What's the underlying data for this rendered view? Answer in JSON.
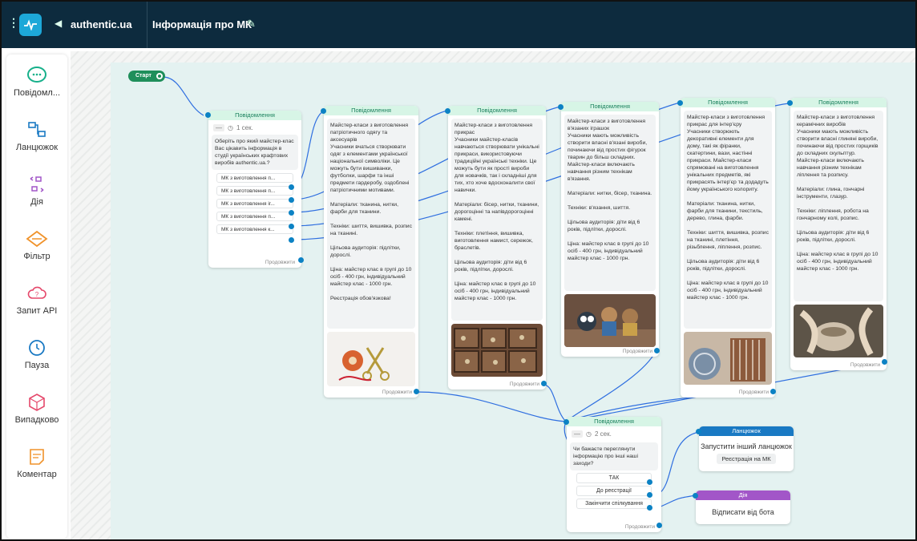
{
  "header": {
    "site": "authentic.ua",
    "title": "Інформація про МК"
  },
  "sidebar": {
    "items": [
      {
        "label": "Повідомл...",
        "icon": "message-bubble-icon"
      },
      {
        "label": "Ланцюжок",
        "icon": "chain-icon"
      },
      {
        "label": "Дія",
        "icon": "action-icon"
      },
      {
        "label": "Фільтр",
        "icon": "filter-icon"
      },
      {
        "label": "Запит API",
        "icon": "api-cloud-icon"
      },
      {
        "label": "Пауза",
        "icon": "clock-icon"
      },
      {
        "label": "Випадково",
        "icon": "dice-icon"
      },
      {
        "label": "Коментар",
        "icon": "note-icon"
      }
    ]
  },
  "colors": {
    "accent": "#1da8d8",
    "header": "#0d2b3e",
    "green": "#1f8f5b",
    "chain": "#1979c3",
    "action": "#a256c8"
  },
  "flow": {
    "start": "Старт",
    "message_header": "Повідомлення",
    "continue": "Продовжити",
    "node1": {
      "delay": "1 сек.",
      "text": "Оберіть про який майстер-клас Вас цікавить інформація в студії українських крафтових виробів authentic.ua.?",
      "options": [
        "МК з виготовлення п...",
        "МК з виготовлення п...",
        "МК з виготовлення іг...",
        "МК з виготовлення п...",
        "МК з виготовлення к..."
      ]
    },
    "node2": {
      "text": "Майстер-класи з виготовлення патріотичного одягу та аксесуарів\nУчасники вчаться створювати одяг з елементами української національної символіки. Це можуть бути вишиванки, футболки, шарфи та інші предмети гардеробу, оздоблені патріотичними мотивами.\n\nМатеріали: тканина, нитки, фарби для тканини.\n\nТехніки: шиття, вишивка, розпис на тканині.\n\nЦільова аудиторія: підлітки, дорослі.\n\nЦіна: майстер клас в групі до 10 осіб - 400 грн, індивідуальний майстер клас - 1000 грн.\n\nРеєстрація обов'язкова!"
    },
    "node3": {
      "text": "Майстер-класи з виготовлення прикрас\nУчасники майстер-класів навчаються створювати унікальні прикраси, використовуючи традиційні українські техніки. Це можуть бути як прості вироби для новачків, так і складніші для тих, хто хоче вдосконалити свої навички.\n\nМатеріали: бісер, нитки, тканини, дорогоцінні та напівдорогоцінні камені.\n\nТехніки: плетіння, вишивка, виготовлення намист, сережок, браслетів.\n\nЦільова аудиторія: діти від 6 років, підлітки, дорослі.\n\nЦіна: майстер клас в групі до 10 осіб - 400 грн, індивідуальний майстер клас - 1000 грн."
    },
    "node4": {
      "text": "Майстер-класи з виготовлення в'язаних іграшок\nУчасники мають можливість створити власні в'язані вироби, починаючи від простих фігурок тварин до більш складних. Майстер-класи включають навчання різним технікам в'язання.\n\nМатеріали: нитки, бісер, тканина.\n\nТехніки: в'язання, шиття.\n\nЦільова аудиторія: діти від 6 років, підлітки, дорослі.\n\nЦіна: майстер клас в групі до 10 осіб - 400 грн, індивідуальний майстер клас - 1000 грн."
    },
    "node5": {
      "text": "Майстер-класи з виготовлення прикрас для інтер'єру\nУчасники створюють декоративні елементи для дому, такі як фіранки, скатертини, вази, настінні прикраси. Майстер-класи спрямовані на виготовлення унікальних предметів, які прикрасять інтер'єр та додадуть йому українського колориту.\n\nМатеріали: тканина, нитки, фарби для тканини, текстиль, дерево, глина, фарби.\n\nТехніки: шиття, вишивка, розпис на тканині, плетіння, різьблення, ліплення, розпис.\n\nЦільова аудиторія: діти від 6 років, підлітки, дорослі.\n\nЦіна: майстер клас в групі до 10 осіб - 400 грн, індивідуальний майстер клас - 1000 грн."
    },
    "node6": {
      "text": "Майстер-класи з виготовлення керамічних виробів\nУчасники мають можливість створити власні глиняні вироби, починаючи від простих горщиків до складних скульптур. Майстер-класи включають навчання різним технікам ліплення та розпису.\n\nМатеріали: глина, гончарні інструменти, глазур.\n\nТехніки: ліплення, робота на гончарному колі, розпис.\n\nЦільова аудиторія: діти від 6 років, підлітки, дорослі.\n\nЦіна: майстер клас в групі до 10 осіб - 400 грн, індивідуальний майстер клас - 1000 грн."
    },
    "node7": {
      "delay": "2 сек.",
      "text": "Чи бажаєте переглянути інформацію про інші наші заходи?",
      "options": [
        "ТАК",
        "До реєстрації",
        "Закінчити спілкування"
      ]
    },
    "chain": {
      "header": "Ланцюжок",
      "title": "Запустити інший ланцюжок",
      "pill": "Реєстрація на МК"
    },
    "action": {
      "header": "Дія",
      "title": "Відписати від бота"
    }
  }
}
